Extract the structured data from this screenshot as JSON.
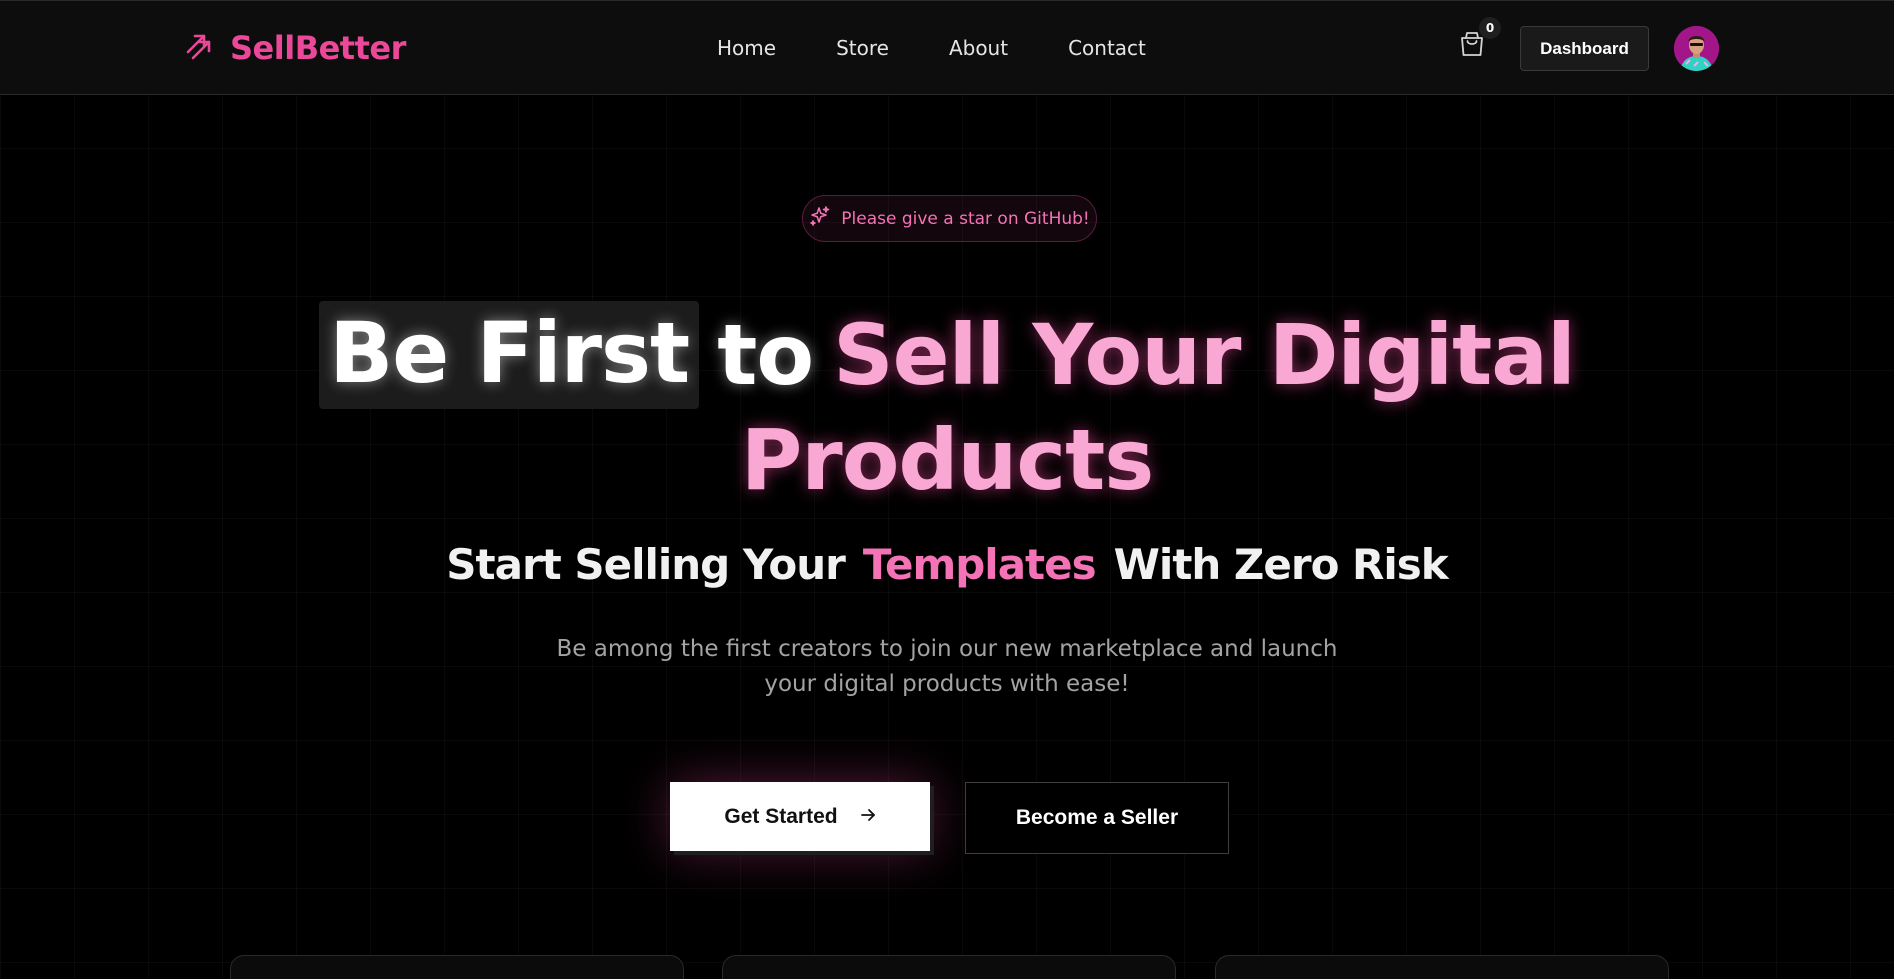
{
  "brand": {
    "name": "SellBetter",
    "icon": "arrow-up-right-icon",
    "color": "#ec4899"
  },
  "nav": {
    "links": [
      "Home",
      "Store",
      "About",
      "Contact"
    ]
  },
  "cart": {
    "icon": "shopping-bag-icon",
    "count": "0"
  },
  "header_actions": {
    "dashboard_label": "Dashboard"
  },
  "hero": {
    "pill_icon": "sparkles-icon",
    "pill_text": "Please give a star on GitHub!",
    "headline": {
      "boxed": "Be First",
      "white": "to",
      "pink_line1": "Sell Your Digital",
      "pink_line2": "Products"
    },
    "subheadline": {
      "before": "Start Selling Your",
      "highlight": "Templates",
      "after": "With Zero Risk"
    },
    "description": "Be among the first creators to join our new marketplace and launch your digital products with ease!",
    "primary_button": "Get Started",
    "primary_button_icon": "arrow-right-icon",
    "secondary_button": "Become a Seller"
  },
  "colors": {
    "accent": "#ec4899",
    "accent_light": "#f9a8d4",
    "background": "#000000"
  }
}
